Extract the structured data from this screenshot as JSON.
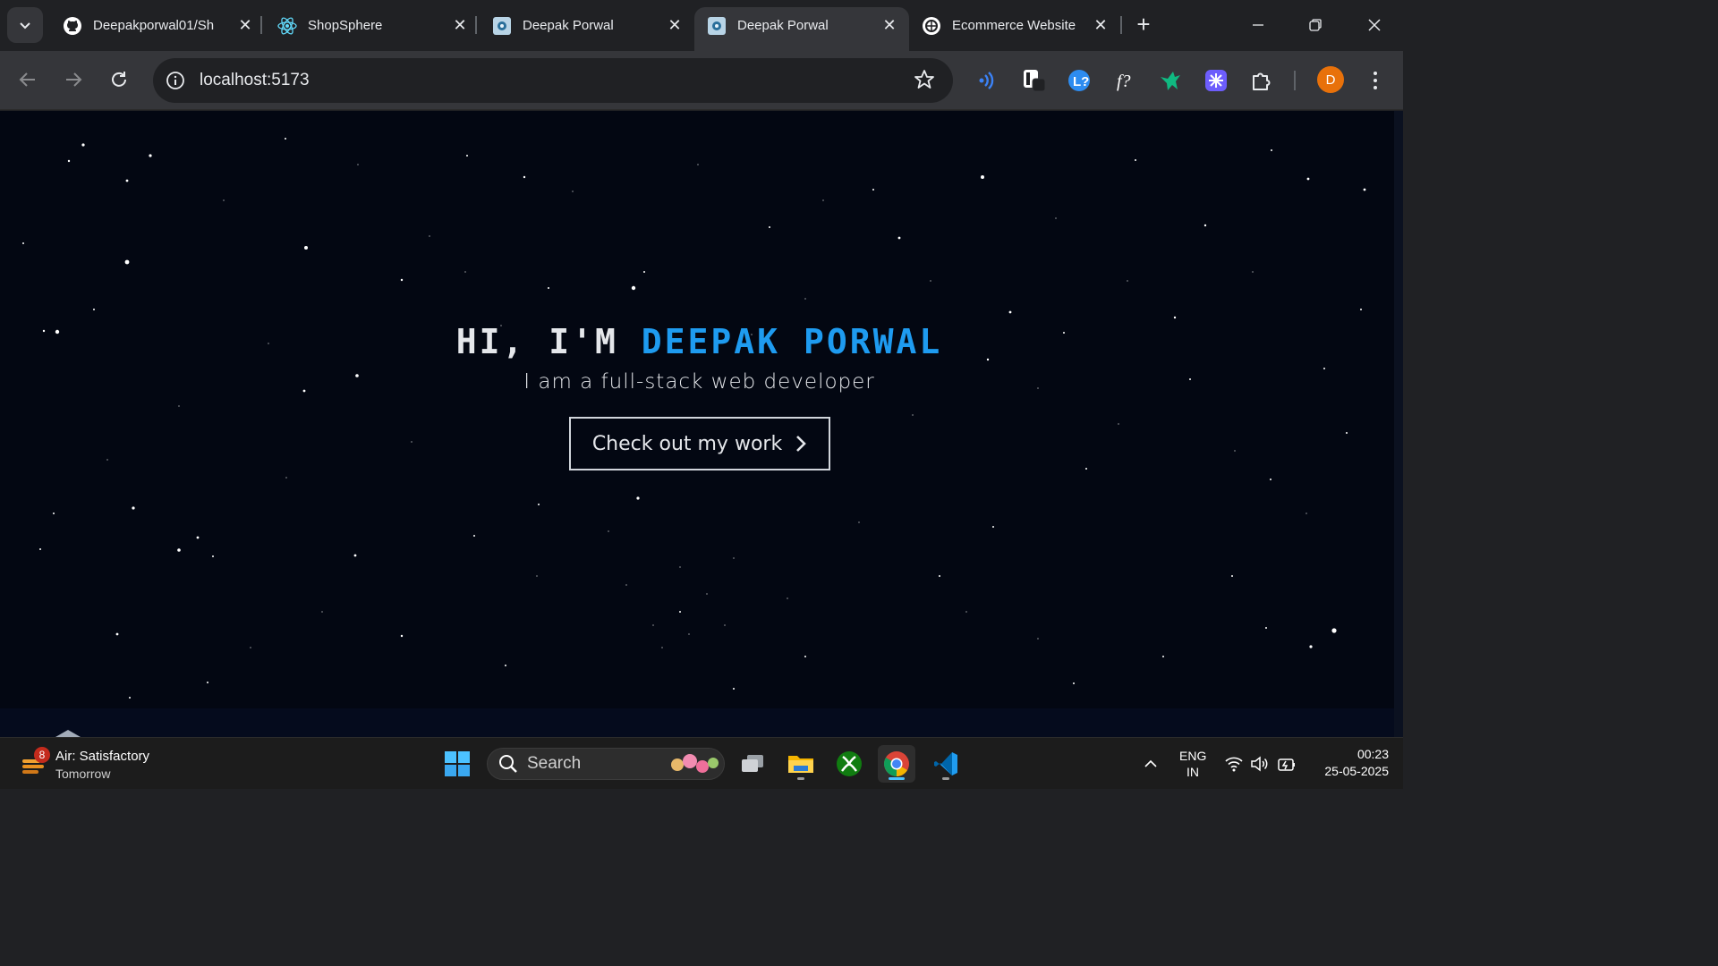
{
  "browser": {
    "tabs": [
      {
        "title": "Deepakporwal01/Sh",
        "icon": "github-icon",
        "active": false
      },
      {
        "title": "ShopSphere",
        "icon": "react-icon",
        "active": false
      },
      {
        "title": "Deepak Porwal",
        "icon": "vite-site-icon",
        "active": false
      },
      {
        "title": "Deepak Porwal",
        "icon": "vite-site-icon",
        "active": true
      },
      {
        "title": "Ecommerce Website",
        "icon": "chatgpt-icon",
        "active": false
      }
    ],
    "address": "localhost:5173",
    "profile_initial": "D",
    "extensions": [
      "wave-icon",
      "notion-ext-icon",
      "leetcode-ext-icon",
      "formula-ext-icon",
      "bird-ext-icon",
      "snowflake-ext-icon",
      "puzzle-icon"
    ]
  },
  "page": {
    "greeting": "HI, I'M ",
    "name": "DEEPAK PORWAL",
    "subtitle": "I am a full-stack web developer",
    "cta_label": "Check out my work",
    "colors": {
      "background": "#030712",
      "accent": "#1e9bf0",
      "text": "#e5e7eb"
    }
  },
  "taskbar": {
    "weather_badge": "8",
    "weather_title": "Air: Satisfactory",
    "weather_sub": "Tomorrow",
    "search_placeholder": "Search",
    "lang_line1": "ENG",
    "lang_line2": "IN",
    "time": "00:23",
    "date": "25-05-2025"
  }
}
